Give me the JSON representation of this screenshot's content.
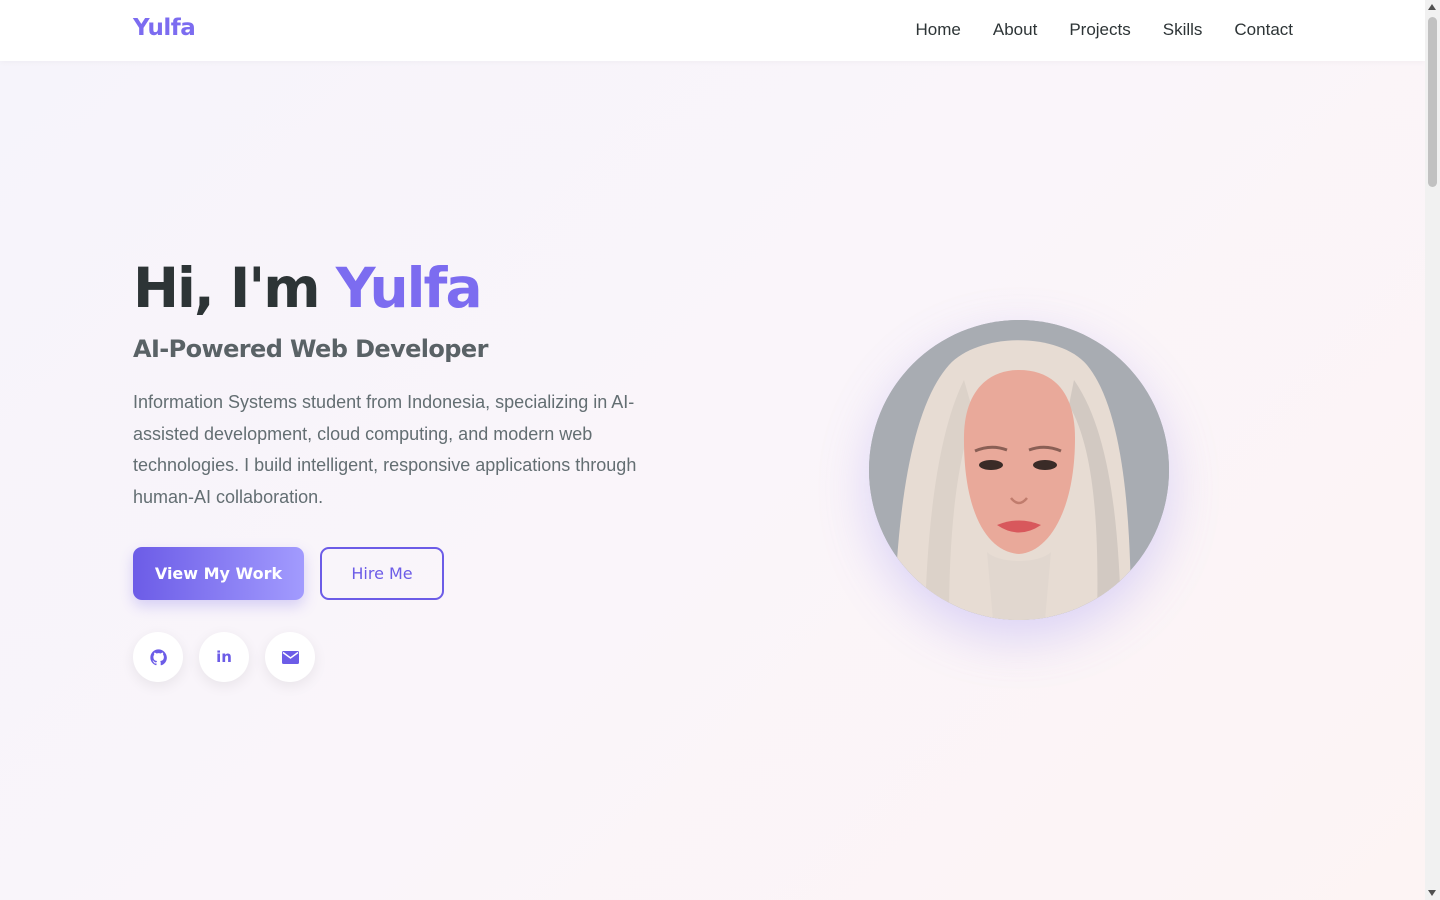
{
  "nav": {
    "logo": "Yulfa",
    "links": [
      "Home",
      "About",
      "Projects",
      "Skills",
      "Contact"
    ]
  },
  "hero": {
    "greeting": "Hi, I'm ",
    "name": "Yulfa",
    "subtitle": "AI-Powered Web Developer",
    "description": "Information Systems student from Indonesia, specializing in AI-assisted development, cloud computing, and modern web technologies. I build intelligent, responsive applications through human-AI collaboration.",
    "primary_button": "View My Work",
    "secondary_button": "Hire Me",
    "social": [
      "github-icon",
      "linkedin-icon",
      "envelope-icon"
    ]
  },
  "colors": {
    "accent": "#7c6cf0",
    "button_gradient_start": "#6c5ce7",
    "button_gradient_end": "#a29bfe",
    "text_dark": "#2d3436"
  }
}
